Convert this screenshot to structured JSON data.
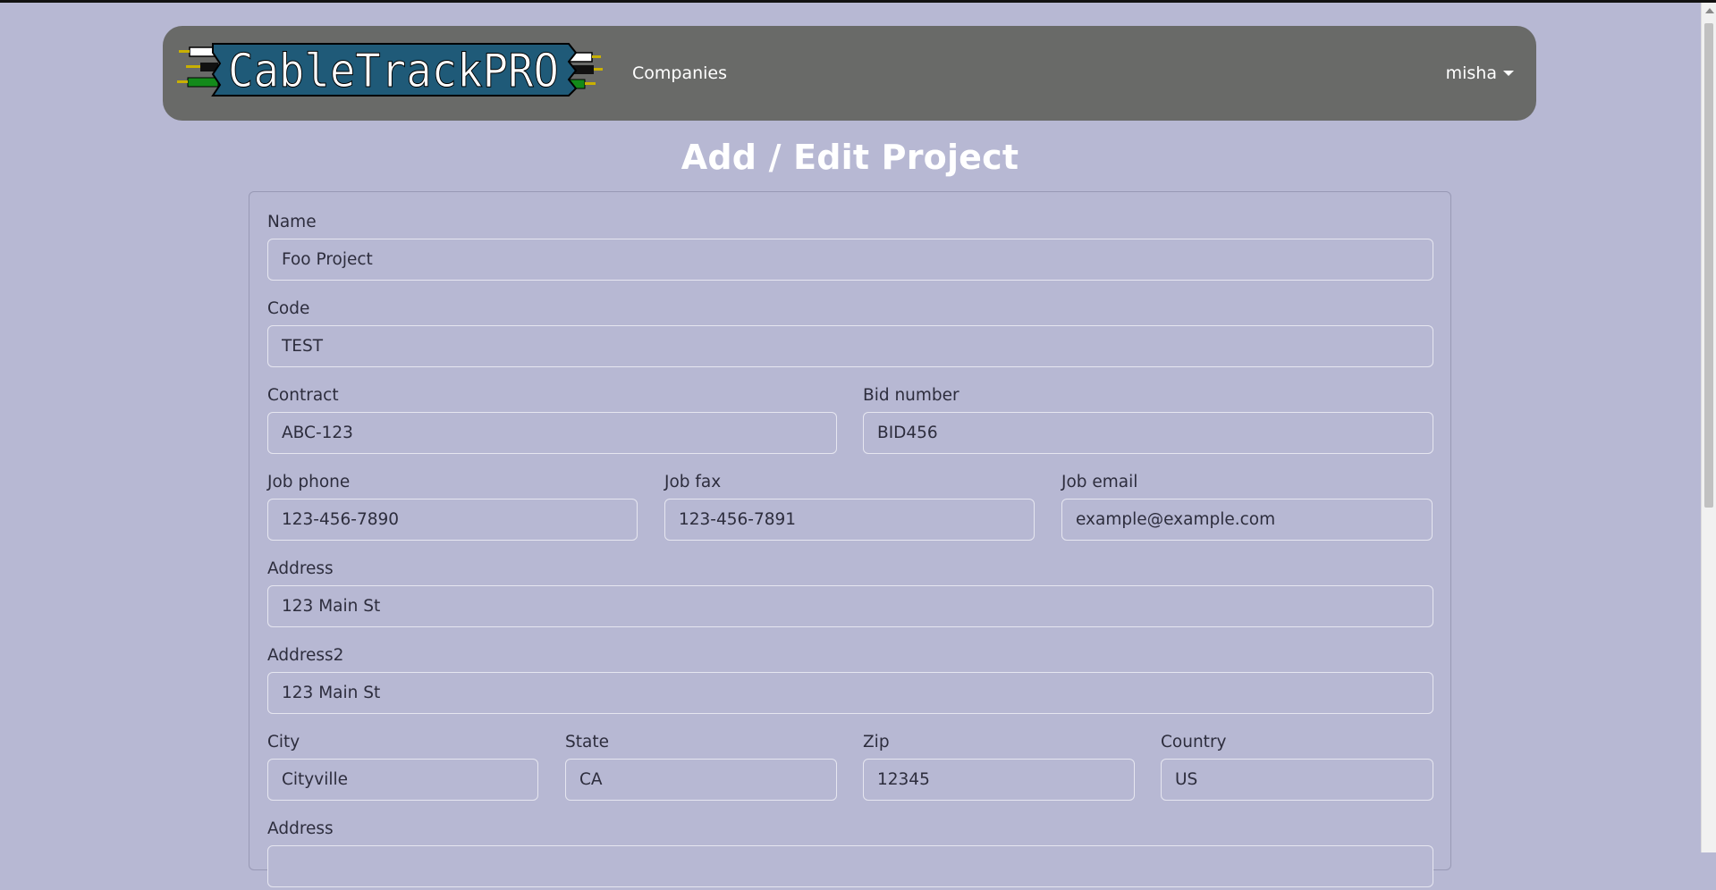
{
  "nav": {
    "logo_text": "CableTrackPRO",
    "companies_label": "Companies",
    "user_label": "misha"
  },
  "page": {
    "title": "Add / Edit Project"
  },
  "form": {
    "name": {
      "label": "Name",
      "value": "Foo Project"
    },
    "code": {
      "label": "Code",
      "value": "TEST"
    },
    "contract": {
      "label": "Contract",
      "value": "ABC-123"
    },
    "bid_number": {
      "label": "Bid number",
      "value": "BID456"
    },
    "job_phone": {
      "label": "Job phone",
      "value": "123-456-7890"
    },
    "job_fax": {
      "label": "Job fax",
      "value": "123-456-7891"
    },
    "job_email": {
      "label": "Job email",
      "value": "example@example.com"
    },
    "address": {
      "label": "Address",
      "value": "123 Main St"
    },
    "address2": {
      "label": "Address2",
      "value": "123 Main St"
    },
    "city": {
      "label": "City",
      "value": "Cityville"
    },
    "state": {
      "label": "State",
      "value": "CA"
    },
    "zip": {
      "label": "Zip",
      "value": "12345"
    },
    "country": {
      "label": "Country",
      "value": "US"
    },
    "address_extra": {
      "label": "Address",
      "value": ""
    }
  },
  "colors": {
    "background": "#b7b8d3",
    "navbar": "#696a68",
    "logo_banner": "#1f5a78"
  }
}
